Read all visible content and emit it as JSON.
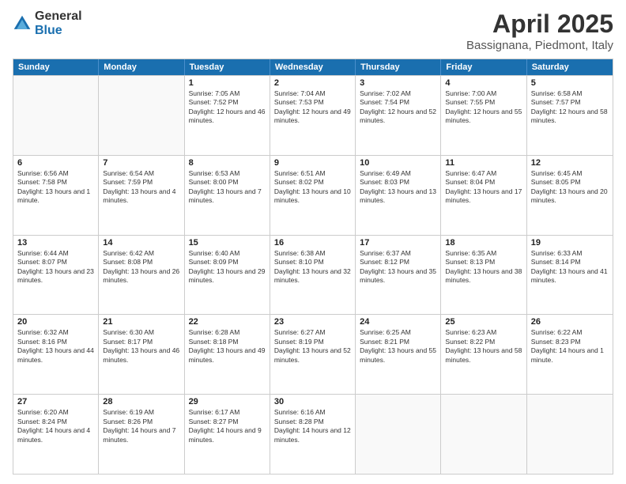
{
  "logo": {
    "general": "General",
    "blue": "Blue"
  },
  "title": {
    "month_year": "April 2025",
    "location": "Bassignana, Piedmont, Italy"
  },
  "header_days": [
    "Sunday",
    "Monday",
    "Tuesday",
    "Wednesday",
    "Thursday",
    "Friday",
    "Saturday"
  ],
  "weeks": [
    [
      {
        "day": "",
        "sunrise": "",
        "sunset": "",
        "daylight": ""
      },
      {
        "day": "",
        "sunrise": "",
        "sunset": "",
        "daylight": ""
      },
      {
        "day": "1",
        "sunrise": "Sunrise: 7:05 AM",
        "sunset": "Sunset: 7:52 PM",
        "daylight": "Daylight: 12 hours and 46 minutes."
      },
      {
        "day": "2",
        "sunrise": "Sunrise: 7:04 AM",
        "sunset": "Sunset: 7:53 PM",
        "daylight": "Daylight: 12 hours and 49 minutes."
      },
      {
        "day": "3",
        "sunrise": "Sunrise: 7:02 AM",
        "sunset": "Sunset: 7:54 PM",
        "daylight": "Daylight: 12 hours and 52 minutes."
      },
      {
        "day": "4",
        "sunrise": "Sunrise: 7:00 AM",
        "sunset": "Sunset: 7:55 PM",
        "daylight": "Daylight: 12 hours and 55 minutes."
      },
      {
        "day": "5",
        "sunrise": "Sunrise: 6:58 AM",
        "sunset": "Sunset: 7:57 PM",
        "daylight": "Daylight: 12 hours and 58 minutes."
      }
    ],
    [
      {
        "day": "6",
        "sunrise": "Sunrise: 6:56 AM",
        "sunset": "Sunset: 7:58 PM",
        "daylight": "Daylight: 13 hours and 1 minute."
      },
      {
        "day": "7",
        "sunrise": "Sunrise: 6:54 AM",
        "sunset": "Sunset: 7:59 PM",
        "daylight": "Daylight: 13 hours and 4 minutes."
      },
      {
        "day": "8",
        "sunrise": "Sunrise: 6:53 AM",
        "sunset": "Sunset: 8:00 PM",
        "daylight": "Daylight: 13 hours and 7 minutes."
      },
      {
        "day": "9",
        "sunrise": "Sunrise: 6:51 AM",
        "sunset": "Sunset: 8:02 PM",
        "daylight": "Daylight: 13 hours and 10 minutes."
      },
      {
        "day": "10",
        "sunrise": "Sunrise: 6:49 AM",
        "sunset": "Sunset: 8:03 PM",
        "daylight": "Daylight: 13 hours and 13 minutes."
      },
      {
        "day": "11",
        "sunrise": "Sunrise: 6:47 AM",
        "sunset": "Sunset: 8:04 PM",
        "daylight": "Daylight: 13 hours and 17 minutes."
      },
      {
        "day": "12",
        "sunrise": "Sunrise: 6:45 AM",
        "sunset": "Sunset: 8:05 PM",
        "daylight": "Daylight: 13 hours and 20 minutes."
      }
    ],
    [
      {
        "day": "13",
        "sunrise": "Sunrise: 6:44 AM",
        "sunset": "Sunset: 8:07 PM",
        "daylight": "Daylight: 13 hours and 23 minutes."
      },
      {
        "day": "14",
        "sunrise": "Sunrise: 6:42 AM",
        "sunset": "Sunset: 8:08 PM",
        "daylight": "Daylight: 13 hours and 26 minutes."
      },
      {
        "day": "15",
        "sunrise": "Sunrise: 6:40 AM",
        "sunset": "Sunset: 8:09 PM",
        "daylight": "Daylight: 13 hours and 29 minutes."
      },
      {
        "day": "16",
        "sunrise": "Sunrise: 6:38 AM",
        "sunset": "Sunset: 8:10 PM",
        "daylight": "Daylight: 13 hours and 32 minutes."
      },
      {
        "day": "17",
        "sunrise": "Sunrise: 6:37 AM",
        "sunset": "Sunset: 8:12 PM",
        "daylight": "Daylight: 13 hours and 35 minutes."
      },
      {
        "day": "18",
        "sunrise": "Sunrise: 6:35 AM",
        "sunset": "Sunset: 8:13 PM",
        "daylight": "Daylight: 13 hours and 38 minutes."
      },
      {
        "day": "19",
        "sunrise": "Sunrise: 6:33 AM",
        "sunset": "Sunset: 8:14 PM",
        "daylight": "Daylight: 13 hours and 41 minutes."
      }
    ],
    [
      {
        "day": "20",
        "sunrise": "Sunrise: 6:32 AM",
        "sunset": "Sunset: 8:16 PM",
        "daylight": "Daylight: 13 hours and 44 minutes."
      },
      {
        "day": "21",
        "sunrise": "Sunrise: 6:30 AM",
        "sunset": "Sunset: 8:17 PM",
        "daylight": "Daylight: 13 hours and 46 minutes."
      },
      {
        "day": "22",
        "sunrise": "Sunrise: 6:28 AM",
        "sunset": "Sunset: 8:18 PM",
        "daylight": "Daylight: 13 hours and 49 minutes."
      },
      {
        "day": "23",
        "sunrise": "Sunrise: 6:27 AM",
        "sunset": "Sunset: 8:19 PM",
        "daylight": "Daylight: 13 hours and 52 minutes."
      },
      {
        "day": "24",
        "sunrise": "Sunrise: 6:25 AM",
        "sunset": "Sunset: 8:21 PM",
        "daylight": "Daylight: 13 hours and 55 minutes."
      },
      {
        "day": "25",
        "sunrise": "Sunrise: 6:23 AM",
        "sunset": "Sunset: 8:22 PM",
        "daylight": "Daylight: 13 hours and 58 minutes."
      },
      {
        "day": "26",
        "sunrise": "Sunrise: 6:22 AM",
        "sunset": "Sunset: 8:23 PM",
        "daylight": "Daylight: 14 hours and 1 minute."
      }
    ],
    [
      {
        "day": "27",
        "sunrise": "Sunrise: 6:20 AM",
        "sunset": "Sunset: 8:24 PM",
        "daylight": "Daylight: 14 hours and 4 minutes."
      },
      {
        "day": "28",
        "sunrise": "Sunrise: 6:19 AM",
        "sunset": "Sunset: 8:26 PM",
        "daylight": "Daylight: 14 hours and 7 minutes."
      },
      {
        "day": "29",
        "sunrise": "Sunrise: 6:17 AM",
        "sunset": "Sunset: 8:27 PM",
        "daylight": "Daylight: 14 hours and 9 minutes."
      },
      {
        "day": "30",
        "sunrise": "Sunrise: 6:16 AM",
        "sunset": "Sunset: 8:28 PM",
        "daylight": "Daylight: 14 hours and 12 minutes."
      },
      {
        "day": "",
        "sunrise": "",
        "sunset": "",
        "daylight": ""
      },
      {
        "day": "",
        "sunrise": "",
        "sunset": "",
        "daylight": ""
      },
      {
        "day": "",
        "sunrise": "",
        "sunset": "",
        "daylight": ""
      }
    ]
  ]
}
